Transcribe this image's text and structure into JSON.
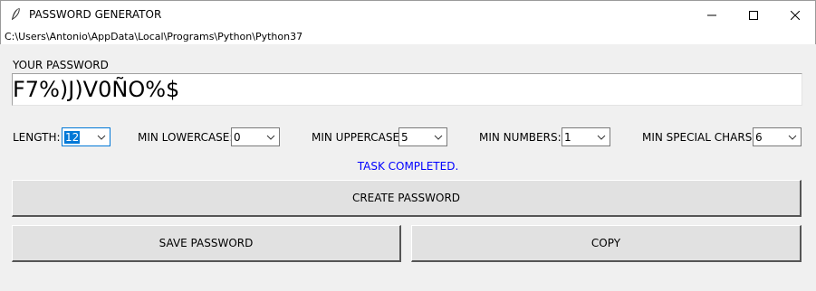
{
  "window": {
    "title": "PASSWORD GENERATOR",
    "minimize_icon": "minimize-icon",
    "maximize_icon": "maximize-icon",
    "close_icon": "close-icon"
  },
  "path": "C:\\Users\\Antonio\\AppData\\Local\\Programs\\Python\\Python37",
  "password": {
    "label": "YOUR PASSWORD",
    "value": "F7%)J)V0ÑO%$"
  },
  "options": {
    "length": {
      "label": "LENGTH:",
      "value": "12"
    },
    "min_lowercase": {
      "label": "MIN LOWERCASE:",
      "value": "0"
    },
    "min_uppercase": {
      "label": "MIN UPPERCASE:",
      "value": "5"
    },
    "min_numbers": {
      "label": "MIN NUMBERS:",
      "value": "1"
    },
    "min_special": {
      "label": "MIN SPECIAL CHARS:",
      "value": "6"
    }
  },
  "status": {
    "text": "TASK COMPLETED.",
    "color": "#0000ff"
  },
  "buttons": {
    "create": "CREATE PASSWORD",
    "save": "SAVE PASSWORD",
    "copy": "COPY"
  },
  "colors": {
    "accent": "#0078d7",
    "background": "#f0f0f0",
    "button_face": "#e1e1e1"
  }
}
